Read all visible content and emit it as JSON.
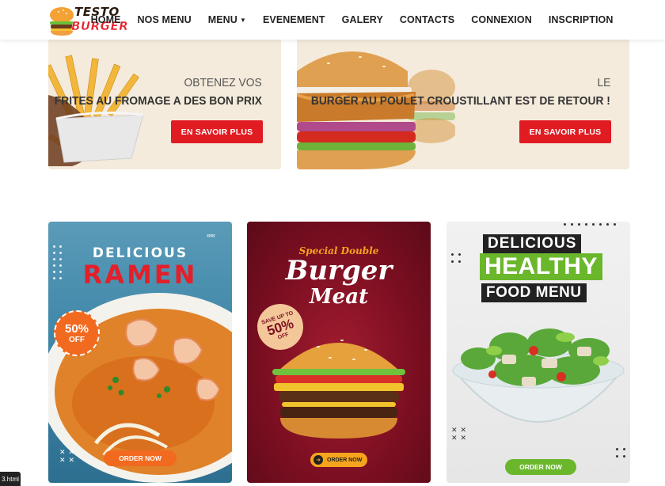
{
  "brand": {
    "line1": "TESTO",
    "line2": "BURGER"
  },
  "nav": {
    "items": [
      {
        "label": "HOME",
        "dropdown": false
      },
      {
        "label": "NOS MENU",
        "dropdown": false
      },
      {
        "label": "MENU",
        "dropdown": true
      },
      {
        "label": "EVENEMENT",
        "dropdown": false
      },
      {
        "label": "GALERY",
        "dropdown": false
      },
      {
        "label": "CONTACTS",
        "dropdown": false
      },
      {
        "label": "CONNEXION",
        "dropdown": false
      },
      {
        "label": "INSCRIPTION",
        "dropdown": false
      }
    ]
  },
  "promos": [
    {
      "line1": "OBTENEZ VOS",
      "line2": "FRITES AU FROMAGE A DES BON PRIX",
      "button": "EN SAVOIR PLUS"
    },
    {
      "line1": "LE",
      "line2": "BURGER AU POULET CROUSTILLANT EST DE RETOUR !",
      "button": "EN SAVOIR PLUS"
    }
  ],
  "cards": {
    "ramen": {
      "title1": "DELICIOUS",
      "title2": "RAMEN",
      "badge_percent": "50%",
      "badge_off": "OFF",
      "button": "ORDER NOW"
    },
    "burger": {
      "special": "Special Double",
      "title1": "Burger",
      "title2": "Meat",
      "save_text": "SAVE UP TO",
      "save_percent": "50%",
      "save_off": "OFF",
      "button": "ORDER NOW"
    },
    "healthy": {
      "line1": "DELICIOUS",
      "line2": "HEALTHY",
      "line3": "FOOD MENU",
      "button": "ORDER NOW"
    }
  },
  "footer_tag": "3.html",
  "colors": {
    "accent_red": "#e11b22",
    "promo_bg": "#f5ebdc",
    "ramen_orange": "#f26a1f",
    "burger_gold": "#f7a41d",
    "healthy_green": "#6bb72c"
  }
}
